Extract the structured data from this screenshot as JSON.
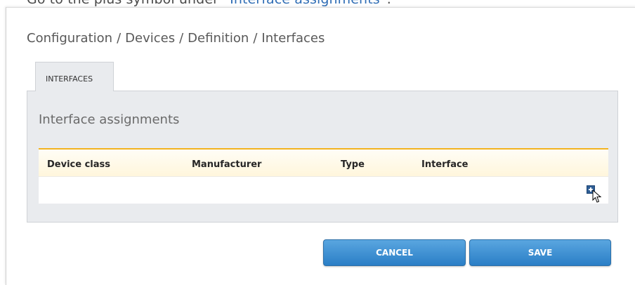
{
  "instruction": {
    "prefix": "Go to the plus symbol under “",
    "highlight": "Interface assignments",
    "suffix": "”."
  },
  "breadcrumb": [
    "Configuration",
    "Devices",
    "Definition",
    "Interfaces"
  ],
  "breadcrumb_separator": "/",
  "tabs": [
    {
      "label": "INTERFACES",
      "active": true
    }
  ],
  "section": {
    "title": "Interface assignments"
  },
  "table": {
    "columns": [
      "Device class",
      "Manufacturer",
      "Type",
      "Interface"
    ],
    "rows": []
  },
  "actions": {
    "add_icon": "plus-icon",
    "cancel_label": "CANCEL",
    "save_label": "SAVE"
  },
  "colors": {
    "accent": "#2a7ec6",
    "header_border": "#f3b320",
    "panel_bg": "#e9ebee",
    "highlight_text": "#2f6db5"
  }
}
